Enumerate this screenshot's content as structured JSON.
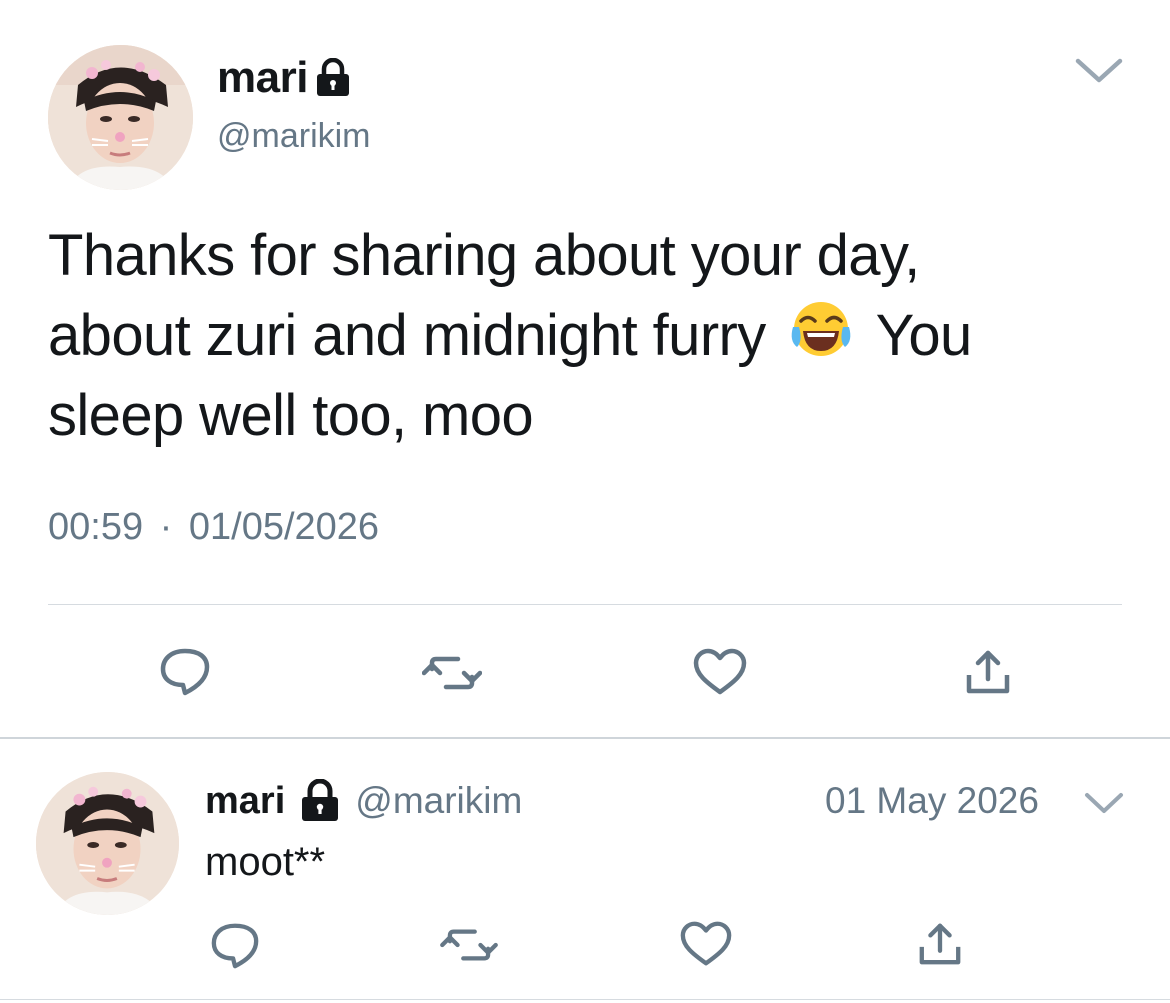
{
  "tweet": {
    "author_name": "mari",
    "author_handle": "@marikim",
    "locked_icon": "lock-icon",
    "text_line1": "Thanks for sharing about your day,",
    "text_line2_before": "about zuri and midnight furry",
    "text_emoji": "face-with-tears-of-joy-emoji",
    "text_line2_after": "You",
    "text_line3": "sleep well too, moo",
    "time": "00:59",
    "separator": "·",
    "date": "01/05/2026",
    "actions": [
      "reply-icon",
      "retweet-icon",
      "like-icon",
      "share-icon"
    ]
  },
  "reply": {
    "author_name": "mari",
    "author_handle": "@marikim",
    "date": "01 May 2026",
    "text": "moot**",
    "actions": [
      "reply-icon",
      "retweet-icon",
      "like-icon",
      "share-icon"
    ]
  },
  "colors": {
    "text": "#14171a",
    "secondary": "#657786",
    "divider": "#d6dbe0"
  }
}
